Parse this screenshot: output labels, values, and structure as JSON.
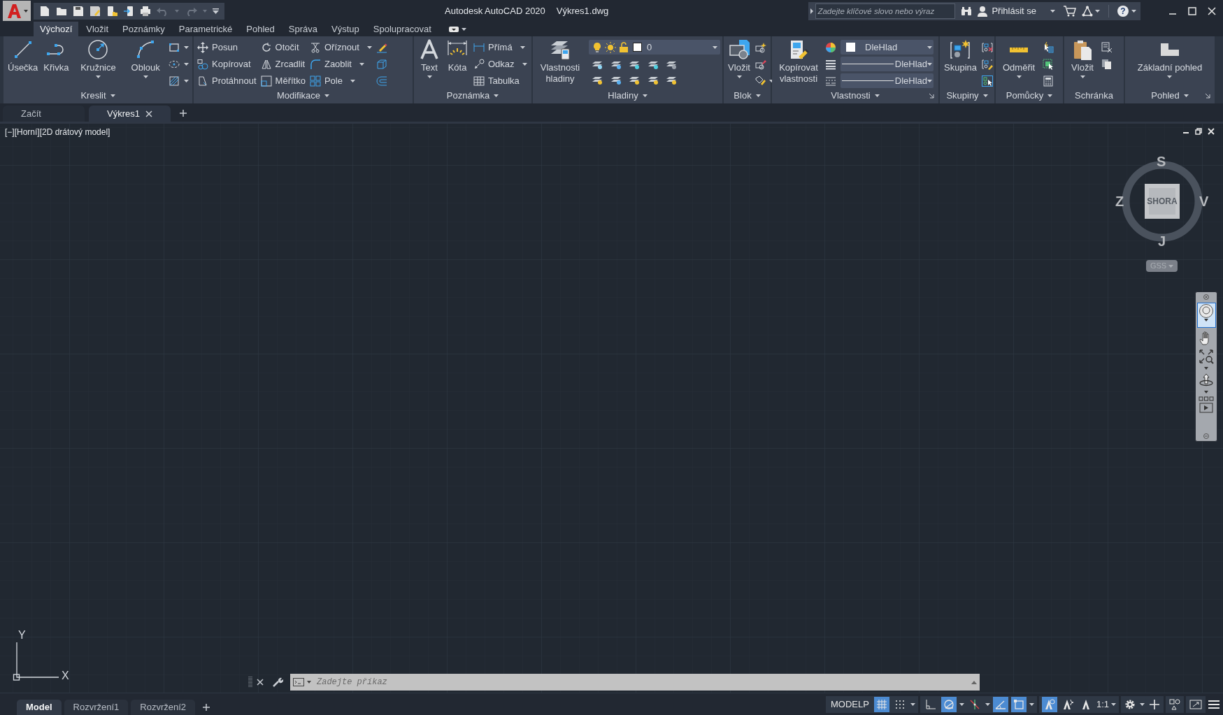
{
  "title_bar": {
    "app_name": "Autodesk AutoCAD 2020",
    "file_name": "Výkres1.dwg",
    "search": {
      "placeholder": "Zadejte klíčové slovo nebo výraz"
    },
    "sign_in": "Přihlásit se",
    "help": "?"
  },
  "ribbon_tabs": [
    {
      "label": "Výchozí",
      "selected": true
    },
    {
      "label": "Vložit",
      "selected": false
    },
    {
      "label": "Poznámky",
      "selected": false
    },
    {
      "label": "Parametrické",
      "selected": false
    },
    {
      "label": "Pohled",
      "selected": false
    },
    {
      "label": "Správa",
      "selected": false
    },
    {
      "label": "Výstup",
      "selected": false
    },
    {
      "label": "Spolupracovat",
      "selected": false
    }
  ],
  "ribbon_panels": [
    {
      "title": "Kreslit",
      "dropdown": true,
      "launcher": false,
      "items": [
        {
          "kind": "large",
          "label": "Úsečka",
          "dropdown": false
        },
        {
          "kind": "large",
          "label": "Křivka",
          "dropdown": false
        },
        {
          "kind": "large",
          "label": "Kružnice",
          "dropdown": true
        },
        {
          "kind": "large",
          "label": "Oblouk",
          "dropdown": true
        }
      ]
    },
    {
      "title": "Modifikace",
      "dropdown": true,
      "launcher": false,
      "items": [
        {
          "kind": "small",
          "label": "Posun",
          "dropdown": false
        },
        {
          "kind": "small",
          "label": "Kopírovat",
          "dropdown": false
        },
        {
          "kind": "small",
          "label": "Protáhnout",
          "dropdown": false
        },
        {
          "kind": "small",
          "label": "Otočit",
          "dropdown": false
        },
        {
          "kind": "small",
          "label": "Zrcadlit",
          "dropdown": false
        },
        {
          "kind": "small",
          "label": "Měřítko",
          "dropdown": false
        },
        {
          "kind": "small",
          "label": "Oříznout",
          "dropdown": true
        },
        {
          "kind": "small",
          "label": "Zaoblit",
          "dropdown": true
        },
        {
          "kind": "small",
          "label": "Pole",
          "dropdown": true
        }
      ]
    },
    {
      "title": "Poznámka",
      "dropdown": true,
      "launcher": false,
      "items": [
        {
          "kind": "large",
          "label": "Text",
          "dropdown": true
        },
        {
          "kind": "large",
          "label": "Kóta",
          "dropdown": false
        },
        {
          "kind": "small",
          "label": "Přímá",
          "dropdown": true
        },
        {
          "kind": "small",
          "label": "Odkaz",
          "dropdown": true
        },
        {
          "kind": "small",
          "label": "Tabulka",
          "dropdown": false
        }
      ]
    },
    {
      "title": "Hladiny",
      "dropdown": true,
      "launcher": false,
      "items": [
        {
          "kind": "large",
          "label": "Vlastnosti hladiny",
          "dropdown": false
        },
        {
          "kind": "combo",
          "value": "0"
        }
      ]
    },
    {
      "title": "Blok",
      "dropdown": true,
      "launcher": false,
      "items": [
        {
          "kind": "large",
          "label": "Vložit",
          "dropdown": true
        }
      ]
    },
    {
      "title": "Vlastnosti",
      "dropdown": true,
      "launcher": true,
      "items": [
        {
          "kind": "large",
          "label": "Kopírovat vlastnosti",
          "dropdown": false
        },
        {
          "kind": "combo",
          "value": "DleHlad"
        },
        {
          "kind": "combo",
          "value": "DleHlad"
        },
        {
          "kind": "combo",
          "value": "DleHlad"
        }
      ]
    },
    {
      "title": "Skupiny",
      "dropdown": true,
      "launcher": false,
      "items": [
        {
          "kind": "large",
          "label": "Skupina",
          "dropdown": false
        }
      ]
    },
    {
      "title": "Pomůcky",
      "dropdown": true,
      "launcher": false,
      "items": [
        {
          "kind": "large",
          "label": "Odměřit",
          "dropdown": true
        }
      ]
    },
    {
      "title": "Schránka",
      "dropdown": false,
      "launcher": false,
      "items": [
        {
          "kind": "large",
          "label": "Vložit",
          "dropdown": true
        }
      ]
    },
    {
      "title": "Pohled",
      "dropdown": true,
      "launcher": true,
      "items": [
        {
          "kind": "large",
          "label": "Základní pohled",
          "dropdown": true
        }
      ]
    }
  ],
  "file_tabs": [
    {
      "label": "Začít",
      "selected": false,
      "closable": false
    },
    {
      "label": "Výkres1",
      "selected": true,
      "closable": true
    }
  ],
  "viewport": {
    "label": "[−][Horní][2D drátový model]",
    "viewcube": {
      "north": "S",
      "west": "Z",
      "east": "V",
      "south": "J",
      "face": "SHORA",
      "ucs": "GSS"
    },
    "ucs_icon": {
      "x": "X",
      "y": "Y"
    }
  },
  "command_line": {
    "placeholder": "Zadejte příkaz"
  },
  "layout_tabs": [
    {
      "label": "Model",
      "selected": true
    },
    {
      "label": "Rozvržení1",
      "selected": false
    },
    {
      "label": "Rozvržení2",
      "selected": false
    }
  ],
  "status_bar": {
    "mode": "MODELP",
    "toggles": [
      {
        "on": true
      },
      {
        "on": false
      },
      {
        "on": false
      },
      {
        "on": true
      },
      {
        "on": false
      },
      {
        "on": true
      },
      {
        "on": true
      },
      {
        "on": true
      },
      {
        "on": false
      },
      {
        "on": false
      }
    ],
    "annotation_scale": "1:1"
  }
}
